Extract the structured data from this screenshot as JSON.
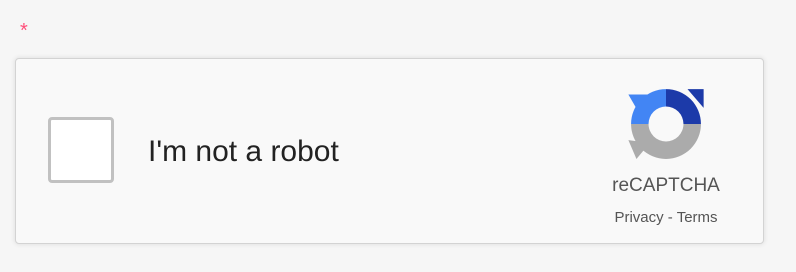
{
  "required_marker": "*",
  "captcha": {
    "label": "I'm not a robot",
    "checked": false,
    "brand": "reCAPTCHA",
    "privacy_link": "Privacy",
    "separator": " - ",
    "terms_link": "Terms",
    "logo_icon": "recaptcha-logo-icon",
    "colors": {
      "logo_blue_dark": "#1c3aa9",
      "logo_blue_light": "#4285f4",
      "logo_gray": "#ababab",
      "required_mark": "#ff4f7a"
    }
  }
}
